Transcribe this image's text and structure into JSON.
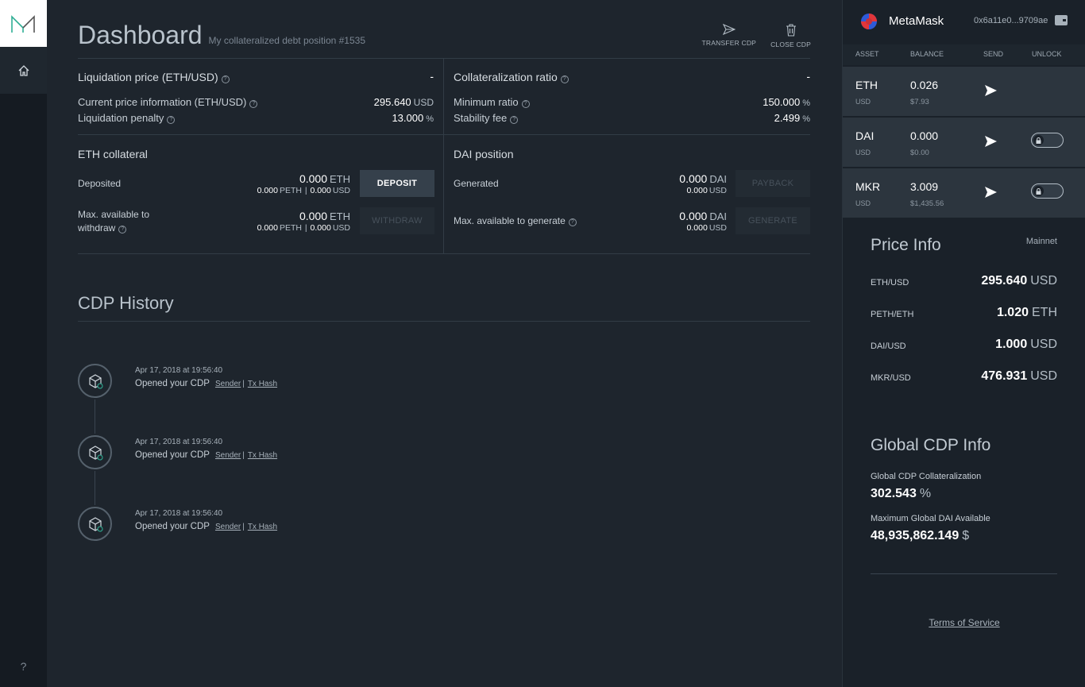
{
  "nav": {
    "help_label": "?"
  },
  "header": {
    "title": "Dashboard",
    "subtitle": "My collateralized debt position #1535",
    "transfer_label": "TRANSFER CDP",
    "close_label": "CLOSE CDP"
  },
  "summary": {
    "liquidation_price_label": "Liquidation price (ETH/USD)",
    "liquidation_price_value": "-",
    "collat_ratio_label": "Collateralization ratio",
    "collat_ratio_value": "-",
    "current_price_label": "Current price information (ETH/USD)",
    "current_price_value": "295.640",
    "current_price_unit": "USD",
    "liq_penalty_label": "Liquidation penalty",
    "liq_penalty_value": "13.000",
    "liq_penalty_unit": "%",
    "min_ratio_label": "Minimum ratio",
    "min_ratio_value": "150.000",
    "min_ratio_unit": "%",
    "stability_fee_label": "Stability fee",
    "stability_fee_value": "2.499",
    "stability_fee_unit": "%"
  },
  "eth_collateral": {
    "title": "ETH collateral",
    "deposited_label": "Deposited",
    "deposited_value": "0.000",
    "deposited_unit": "ETH",
    "deposited_peth": "0.000",
    "deposited_usd": "0.000",
    "max_withdraw_label_1": "Max. available to",
    "max_withdraw_label_2": "withdraw",
    "max_withdraw_value": "0.000",
    "max_withdraw_unit": "ETH",
    "max_withdraw_peth": "0.000",
    "max_withdraw_usd": "0.000",
    "peth_unit": "PETH",
    "usd_unit": "USD",
    "sep": "|",
    "deposit_label": "DEPOSIT",
    "withdraw_label": "WITHDRAW"
  },
  "dai_position": {
    "title": "DAI position",
    "generated_label": "Generated",
    "generated_value": "0.000",
    "generated_unit": "DAI",
    "generated_usd": "0.000",
    "max_generate_label": "Max. available to generate",
    "max_generate_value": "0.000",
    "max_generate_unit": "DAI",
    "max_generate_usd": "0.000",
    "usd_unit": "USD",
    "payback_label": "PAYBACK",
    "generate_label": "GENERATE"
  },
  "history": {
    "title": "CDP History",
    "sender_label": "Sender",
    "sep": "|",
    "txhash_label": "Tx Hash",
    "items": [
      {
        "date": "Apr 17, 2018 at 19:56:40",
        "text": "Opened your CDP"
      },
      {
        "date": "Apr 17, 2018 at 19:56:40",
        "text": "Opened your CDP"
      },
      {
        "date": "Apr 17, 2018 at 19:56:40",
        "text": "Opened your CDP"
      }
    ]
  },
  "wallet": {
    "name": "MetaMask",
    "address": "0x6a11e0...9709ae",
    "columns": {
      "asset": "ASSET",
      "balance": "BALANCE",
      "send": "SEND",
      "unlock": "UNLOCK"
    },
    "assets": [
      {
        "symbol": "ETH",
        "unit": "USD",
        "balance": "0.026",
        "balance_usd": "$7.93",
        "has_unlock": false
      },
      {
        "symbol": "DAI",
        "unit": "USD",
        "balance": "0.000",
        "balance_usd": "$0.00",
        "has_unlock": true
      },
      {
        "symbol": "MKR",
        "unit": "USD",
        "balance": "3.009",
        "balance_usd": "$1,435.56",
        "has_unlock": true
      }
    ]
  },
  "price_info": {
    "title": "Price Info",
    "network": "Mainnet",
    "rows": [
      {
        "pair": "ETH/USD",
        "value": "295.640",
        "unit": "USD"
      },
      {
        "pair": "PETH/ETH",
        "value": "1.020",
        "unit": "ETH"
      },
      {
        "pair": "DAI/USD",
        "value": "1.000",
        "unit": "USD"
      },
      {
        "pair": "MKR/USD",
        "value": "476.931",
        "unit": "USD"
      }
    ]
  },
  "global_info": {
    "title": "Global CDP Info",
    "collat_label": "Global CDP Collateralization",
    "collat_value": "302.543",
    "collat_unit": "%",
    "max_dai_label": "Maximum Global DAI Available",
    "max_dai_value": "48,935,862.149",
    "max_dai_unit": "$"
  },
  "footer": {
    "tos": "Terms of Service"
  },
  "colors": {
    "bg": "#1e252d",
    "panel": "#1a2129",
    "row": "#2c353e",
    "accent": "#2fae94"
  }
}
